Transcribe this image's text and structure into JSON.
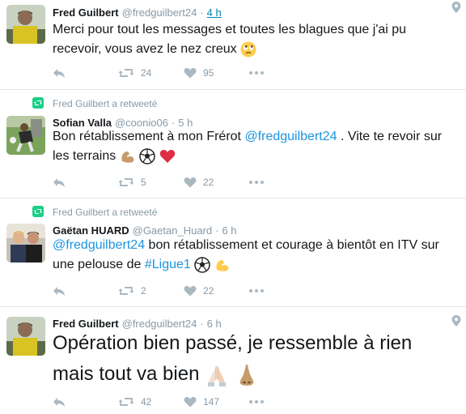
{
  "tweets": [
    {
      "retweeted_by": "",
      "name": "Fred Guilbert",
      "handle": "@fredguilbert24",
      "sep": "·",
      "time": "4 h",
      "text": "Merci pour tout les messages et toutes les blagues que j'ai pu recevoir, vous avez le nez creux",
      "retweets": "24",
      "likes": "95",
      "avatar_colors": [
        "#d9c323",
        "#2d2a26",
        "#8b6b55"
      ]
    },
    {
      "retweeted_by": "Fred Guilbert a retweeté",
      "name": "Sofian Valla",
      "handle": "@coonio06",
      "sep": "·",
      "time": "5 h",
      "text_pre": "Bon rétablissement à mon Frérot ",
      "mention": "@fredguilbert24",
      "text_post": " . Vite te revoir sur les terrains",
      "retweets": "5",
      "likes": "22"
    },
    {
      "retweeted_by": "Fred Guilbert a retweeté",
      "name": "Gaëtan HUARD",
      "handle": "@Gaetan_Huard",
      "sep": "·",
      "time": "6 h",
      "mention": "@fredguilbert24",
      "text_mid": " bon rétablissement et courage à bientôt en ITV sur une pelouse de ",
      "hashtag": "#Ligue1",
      "retweets": "2",
      "likes": "22"
    },
    {
      "retweeted_by": "",
      "name": "Fred Guilbert",
      "handle": "@fredguilbert24",
      "sep": "·",
      "time": "6 h",
      "text": "Opération bien passé, je ressemble à rien mais tout va bien",
      "retweets": "42",
      "likes": "147"
    }
  ],
  "colors": {
    "link": "#1b95e0",
    "meta": "#8899a6",
    "retweet_badge": "#19cf86",
    "divider": "#e1e8ed"
  },
  "icons": [
    "reply-icon",
    "retweet-icon",
    "heart-icon",
    "more-icon",
    "location-pin-icon"
  ]
}
